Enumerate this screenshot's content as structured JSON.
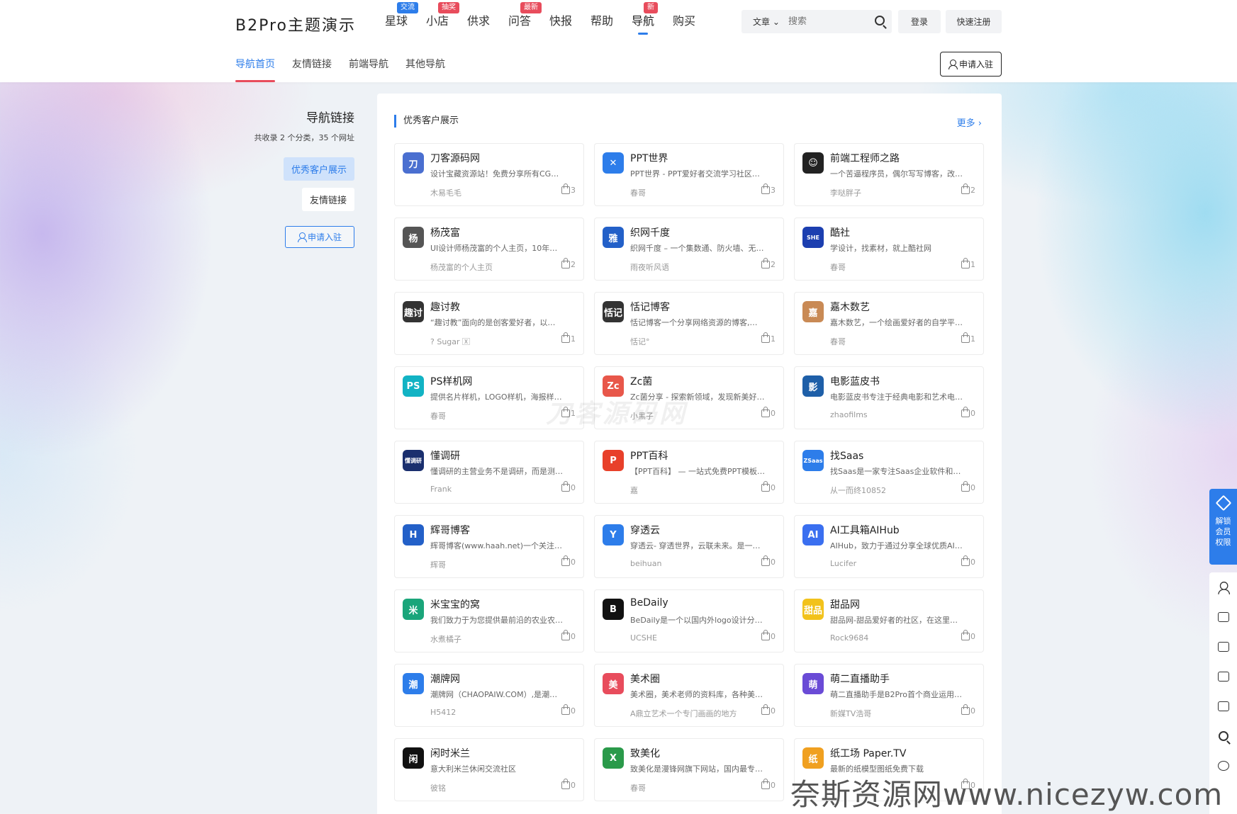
{
  "header": {
    "logo": "B2Pro主题演示",
    "nav": [
      {
        "label": "星球",
        "badge": "交流",
        "badge_color": "#2d7dea"
      },
      {
        "label": "小店",
        "badge": "抽奖",
        "badge_color": "#e84c5c"
      },
      {
        "label": "供求",
        "badge": ""
      },
      {
        "label": "问答",
        "badge": "最新",
        "badge_color": "#e84c5c"
      },
      {
        "label": "快报",
        "badge": ""
      },
      {
        "label": "帮助",
        "badge": ""
      },
      {
        "label": "导航",
        "badge": "新",
        "badge_color": "#e84c5c",
        "active": true
      },
      {
        "label": "购买",
        "badge": ""
      }
    ],
    "search_type": "文章",
    "search_placeholder": "搜索",
    "login": "登录",
    "register": "快速注册"
  },
  "subnav": {
    "items": [
      "导航首页",
      "友情链接",
      "前端导航",
      "其他导航"
    ],
    "apply": "申请入驻"
  },
  "sidebar": {
    "title": "导航链接",
    "subtitle": "共收录 2 个分类，35 个网址",
    "links": [
      "优秀客户展示",
      "友情链接"
    ],
    "apply": "申请入驻"
  },
  "section": {
    "title": "优秀客户展示",
    "more": "更多 ›"
  },
  "cards": [
    {
      "title": "刀客源码网",
      "desc": "设计宝藏资源站！免费分享所有CG…",
      "author": "木易毛毛",
      "likes": "3",
      "icon_text": "刀",
      "icon_color": "#4a6fd0"
    },
    {
      "title": "PPT世界",
      "desc": "PPT世界 - PPT爱好者交流学习社区…",
      "author": "春哥",
      "likes": "3",
      "icon_text": "✕",
      "icon_color": "#2d7dea"
    },
    {
      "title": "前端工程师之路",
      "desc": "一个苦逼程序员，偶尔写写博客，改…",
      "author": "李哒胖子",
      "likes": "2",
      "icon_text": "☺",
      "icon_color": "#222"
    },
    {
      "title": "杨茂富",
      "desc": "UI设计师杨茂富的个人主页，10年…",
      "author": "杨茂富的个人主页",
      "likes": "2",
      "icon_text": "杨",
      "icon_color": "#555"
    },
    {
      "title": "织网千度",
      "desc": "织网千度 – 一个集数通、防火墙、无…",
      "author": "雨夜听风语",
      "likes": "2",
      "icon_text": "雅",
      "icon_color": "#2360c8"
    },
    {
      "title": "酷社",
      "desc": "学设计，找素材，就上酷社网",
      "author": "春哥",
      "likes": "1",
      "icon_text": "SHE",
      "icon_color": "#1c3fb0"
    },
    {
      "title": "趣讨教",
      "desc": "“趣讨教”面向的是创客爱好者，以…",
      "author": "? Sugar 🅇",
      "likes": "1",
      "icon_text": "趣讨",
      "icon_color": "#333"
    },
    {
      "title": "恬记博客",
      "desc": "恬记博客一个分享网络资源的博客,…",
      "author": "恬记°",
      "likes": "1",
      "icon_text": "恬记",
      "icon_color": "#333"
    },
    {
      "title": "嘉木数艺",
      "desc": "嘉木数艺，一个绘画爱好者的自学平…",
      "author": "春哥",
      "likes": "1",
      "icon_text": "嘉",
      "icon_color": "#c98a55"
    },
    {
      "title": "PS样机网",
      "desc": "提供名片样机，LOGO样机，海报样…",
      "author": "春哥",
      "likes": "1",
      "icon_text": "PS",
      "icon_color": "#12b3c4"
    },
    {
      "title": "Zc菌",
      "desc": "Zc菌分享 - 探索新领域，发现新美好…",
      "author": "小黑子",
      "likes": "0",
      "icon_text": "Zc",
      "icon_color": "#e8574a"
    },
    {
      "title": "电影蓝皮书",
      "desc": "电影蓝皮书专注于经典电影和艺术电…",
      "author": "zhaofilms",
      "likes": "0",
      "icon_text": "影",
      "icon_color": "#1e5fa8"
    },
    {
      "title": "懂调研",
      "desc": "懂调研的主营业务不是调研，而是测…",
      "author": "Frank",
      "likes": "0",
      "icon_text": "懂调研",
      "icon_color": "#1a2f6e"
    },
    {
      "title": "PPT百科",
      "desc": "【PPT百科】 — 一站式免费PPT模板…",
      "author": "嘉",
      "likes": "0",
      "icon_text": "P",
      "icon_color": "#e8402a"
    },
    {
      "title": "找Saas",
      "desc": "找Saas是一家专注Saas企业软件和…",
      "author": "从一而终10852",
      "likes": "0",
      "icon_text": "ZSaas",
      "icon_color": "#2d7dea"
    },
    {
      "title": "辉哥博客",
      "desc": "辉哥博客(www.haah.net)一个关注…",
      "author": "辉哥",
      "likes": "0",
      "icon_text": "H",
      "icon_color": "#2360c8"
    },
    {
      "title": "穿透云",
      "desc": "穿透云- 穿透世界，云联未来。是一…",
      "author": "beihuan",
      "likes": "0",
      "icon_text": "Y",
      "icon_color": "#2d7dea"
    },
    {
      "title": "AI工具箱AIHub",
      "desc": "AIHub，致力于通过分享全球优质AI…",
      "author": "Lucifer",
      "likes": "0",
      "icon_text": "AI",
      "icon_color": "#3a6ff0"
    },
    {
      "title": "米宝宝的窝",
      "desc": "我们致力于为您提供最前沿的农业农…",
      "author": "水煮橘子",
      "likes": "0",
      "icon_text": "米",
      "icon_color": "#1aa57a"
    },
    {
      "title": "BeDaily",
      "desc": "BeDaily是一个以国内外logo设计分…",
      "author": "UCSHE",
      "likes": "0",
      "icon_text": "B",
      "icon_color": "#111"
    },
    {
      "title": "甜品网",
      "desc": "甜品网-甜品爱好者的社区，在这里…",
      "author": "Rock9684",
      "likes": "0",
      "icon_text": "甜品",
      "icon_color": "#f2c21b"
    },
    {
      "title": "潮牌网",
      "desc": "潮牌网（CHAOPAIW.COM）,是潮…",
      "author": "H5412",
      "likes": "0",
      "icon_text": "潮",
      "icon_color": "#2d7dea"
    },
    {
      "title": "美术圈",
      "desc": "美术圈，美术老师的资料库，各种美…",
      "author": "A鼎立艺术一个专门画画的地方",
      "likes": "0",
      "icon_text": "美",
      "icon_color": "#e84c5c"
    },
    {
      "title": "萌二直播助手",
      "desc": "萌二直播助手是B2Pro首个商业运用…",
      "author": "新媒TV浩哥",
      "likes": "0",
      "icon_text": "萌",
      "icon_color": "#6a4bd6"
    },
    {
      "title": "闲时米兰",
      "desc": "意大利米兰休闲交流社区",
      "author": "彼铭",
      "likes": "0",
      "icon_text": "闲",
      "icon_color": "#111"
    },
    {
      "title": "致美化",
      "desc": "致美化是漫锋网旗下网站，国内最专…",
      "author": "春哥",
      "likes": "0",
      "icon_text": "X",
      "icon_color": "#2a9a4a"
    },
    {
      "title": "纸工场 Paper.TV",
      "desc": "最新的纸模型图纸免费下载",
      "author": "",
      "likes": "0",
      "icon_text": "纸",
      "icon_color": "#f0a020"
    }
  ],
  "right_bar": {
    "vip": "解锁会员权限"
  },
  "watermark": {
    "bottom": "奈斯资源网www.nicezyw.com",
    "center": "刀客源码网"
  }
}
